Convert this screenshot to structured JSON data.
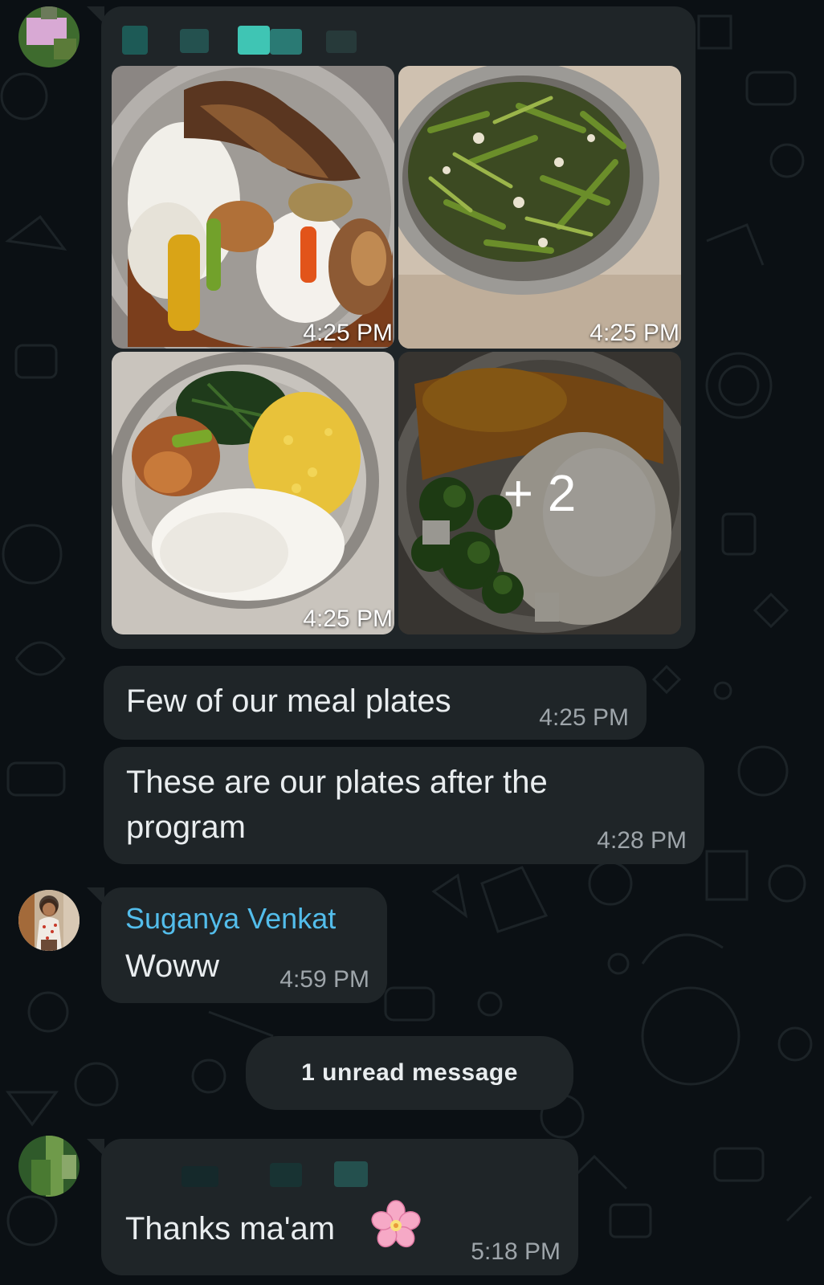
{
  "colors": {
    "background": "#0b1014",
    "bubble": "#1f2528",
    "text": "#e9edef",
    "timestamp": "#9ea5aa",
    "sender_name": "#53bdeb"
  },
  "album": {
    "photos": [
      {
        "time": "4:25 PM",
        "description": "fish-curry-rice-plate"
      },
      {
        "time": "4:25 PM",
        "description": "green-beans-stir-fry-bowl"
      },
      {
        "time": "4:25 PM",
        "description": "rice-dal-greens-plate"
      },
      {
        "time": "",
        "description": "rice-broccoli-sambar-plate",
        "more_label": "+ 2"
      }
    ]
  },
  "messages": [
    {
      "text": "Few of our meal plates",
      "time": "4:25 PM"
    },
    {
      "text_line1": "These are our plates after the",
      "text_line2": "program",
      "time": "4:28 PM"
    },
    {
      "sender": "Suganya Venkat",
      "text": "Woww",
      "time": "4:59 PM"
    },
    {
      "text": "Thanks ma'am",
      "emoji": "🌸",
      "time": "5:18 PM"
    }
  ],
  "unread_banner": "1 unread message"
}
